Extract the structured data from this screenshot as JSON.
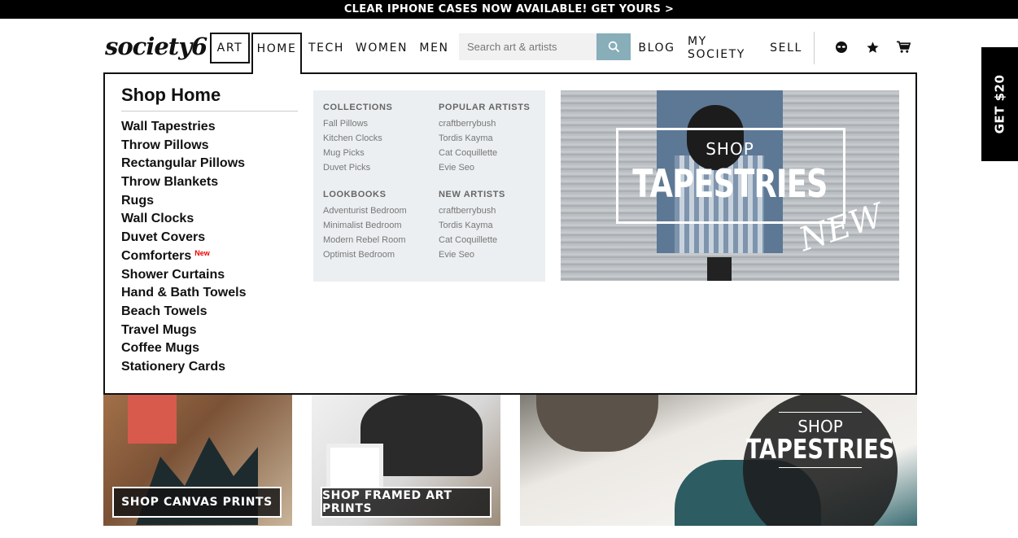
{
  "promo_bar": "CLEAR IPHONE CASES NOW AVAILABLE! GET YOURS >",
  "logo": "society6",
  "nav": {
    "art": "ART",
    "home": "HOME",
    "tech": "TECH",
    "women": "WOMEN",
    "men": "MEN",
    "blog": "BLOG",
    "my_society": "MY SOCIETY",
    "sell": "SELL"
  },
  "search": {
    "placeholder": "Search art & artists"
  },
  "icons": {
    "search": "search-icon",
    "account": "alien-head-icon",
    "favorites": "star-icon",
    "cart": "cart-icon"
  },
  "side_tab": "GET $20",
  "dropdown": {
    "title": "Shop Home",
    "items": [
      "Wall Tapestries",
      "Throw Pillows",
      "Rectangular Pillows",
      "Throw Blankets",
      "Rugs",
      "Wall Clocks",
      "Duvet Covers",
      "Comforters",
      "Shower Curtains",
      "Hand & Bath Towels",
      "Beach Towels",
      "Travel Mugs",
      "Coffee Mugs",
      "Stationery Cards"
    ],
    "new_badge": "New",
    "collections": {
      "heading": "COLLECTIONS",
      "items": [
        "Fall Pillows",
        "Kitchen Clocks",
        "Mug Picks",
        "Duvet Picks"
      ]
    },
    "popular_artists": {
      "heading": "POPULAR ARTISTS",
      "items": [
        "craftberrybush",
        "Tordis Kayma",
        "Cat Coquillette",
        "Evie Seo"
      ]
    },
    "lookbooks": {
      "heading": "LOOKBOOKS",
      "items": [
        "Adventurist Bedroom",
        "Minimalist Bedroom",
        "Modern Rebel Room",
        "Optimist Bedroom"
      ]
    },
    "new_artists": {
      "heading": "NEW ARTISTS",
      "items": [
        "craftberrybush",
        "Tordis Kayma",
        "Cat Coquillette",
        "Evie Seo"
      ]
    },
    "promo": {
      "shop": "SHOP",
      "title": "TAPESTRIES",
      "tag": "NEW"
    }
  },
  "tiles": {
    "canvas": "SHOP CANVAS PRINTS",
    "framed": "SHOP FRAMED ART PRINTS",
    "tapestries_shop": "SHOP",
    "tapestries_title": "TAPESTRIES"
  },
  "colors": {
    "accent": "#87aeb9",
    "new_badge": "#e00000",
    "dropdown_panel": "#eceff1"
  }
}
